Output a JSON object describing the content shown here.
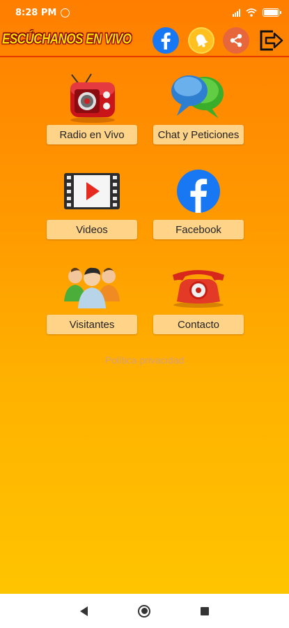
{
  "status_bar": {
    "time": "8:28 PM",
    "icons": [
      "whatsapp-icon",
      "signal-icon",
      "wifi-icon",
      "battery-icon"
    ]
  },
  "toolbar": {
    "logo_text": "ESCÚCHANOS EN VIVO",
    "buttons": [
      "facebook-icon",
      "bell-icon",
      "share-icon",
      "exit-icon"
    ]
  },
  "menu": {
    "radio": "Radio en Vivo",
    "chat": "Chat y Peticiones",
    "videos": "Videos",
    "facebook": "Facebook",
    "visitors": "Visitantes",
    "contact": "Contacto"
  },
  "privacy_link": "Política privacidad",
  "colors": {
    "bg_top": "#ff7e00",
    "bg_bottom": "#ffc400",
    "label_bg": "#ffd489",
    "facebook_blue": "#1877f2"
  }
}
